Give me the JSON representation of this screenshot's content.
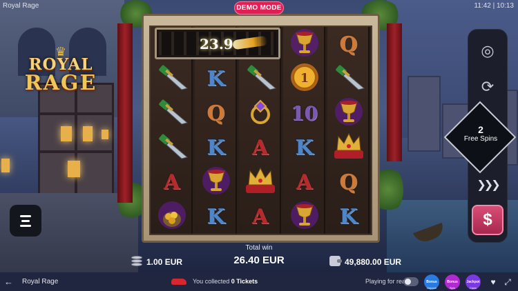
{
  "status": {
    "game_label": "Royal Rage",
    "clock": "11:42 | 10:13"
  },
  "demo_badge": "DEMO MODE",
  "logo": {
    "line1": "ROYAL",
    "line2": "RAGE"
  },
  "multiplier": {
    "value": "23.9"
  },
  "reels": [
    [
      "dagger",
      "dagger",
      "dagger",
      "A",
      "gold-bag"
    ],
    [
      "K",
      "Q",
      "K",
      "goblet",
      "K"
    ],
    [
      "dagger",
      "ring",
      "A",
      "crown",
      "A"
    ],
    [
      "gold-coin",
      "10",
      "K",
      "A",
      "goblet"
    ],
    [
      "dagger",
      "goblet",
      "crown",
      "Q",
      "K"
    ]
  ],
  "top_row_extra": [
    "goblet",
    "Q"
  ],
  "controls": {
    "free_spins_count": "2",
    "free_spins_label": "Free Spins",
    "spin_symbol": "$"
  },
  "info": {
    "bet": "1.00 EUR",
    "win_label": "Total win",
    "win_value": "26.40 EUR",
    "balance": "49,880.00 EUR"
  },
  "bottom": {
    "title": "Royal Rage",
    "tickets_prefix": "You collected ",
    "tickets_count": "0 Tickets",
    "play_real": "Playing for real",
    "promos": [
      {
        "label": "Bonus",
        "sub": "Deposit",
        "color": "#2a7be0"
      },
      {
        "label": "Bonus",
        "sub": "Spin",
        "color": "#b02ad0"
      },
      {
        "label": "Jackpot",
        "sub": "Claim",
        "color": "#7a3ae0"
      }
    ]
  },
  "colors": {
    "accent": "#e21f55",
    "bar": "#202640",
    "panel": "#1c1f2b"
  }
}
